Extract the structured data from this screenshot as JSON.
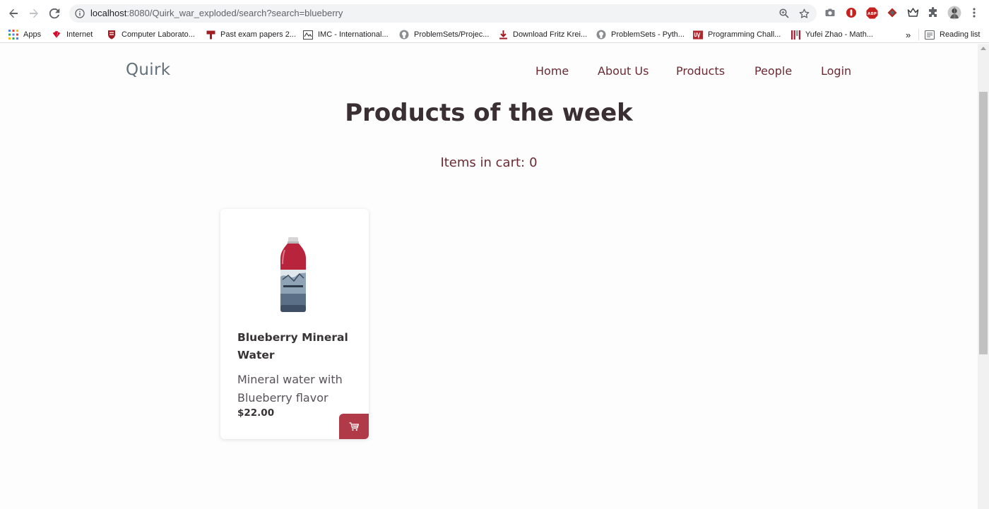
{
  "browser": {
    "url_host": "localhost",
    "url_rest": ":8080/Quirk_war_exploded/search?search=blueberry",
    "bookmarks": [
      {
        "label": "Apps"
      },
      {
        "label": "Internet"
      },
      {
        "label": "Computer Laborato..."
      },
      {
        "label": "Past exam papers 2..."
      },
      {
        "label": "IMC - International..."
      },
      {
        "label": "ProblemSets/Projec..."
      },
      {
        "label": "Download Fritz Krei..."
      },
      {
        "label": "ProblemSets - Pyth..."
      },
      {
        "label": "Programming Chall..."
      },
      {
        "label": "Yufei Zhao - Math..."
      }
    ],
    "overflow_label": "»",
    "reading_list": "Reading list",
    "ext_abp_label": "ABP"
  },
  "site": {
    "brand": "Quirk",
    "nav": [
      {
        "label": "Home"
      },
      {
        "label": "About Us"
      },
      {
        "label": "Products"
      },
      {
        "label": "People"
      },
      {
        "label": "Login"
      }
    ]
  },
  "main": {
    "title": "Products of the week",
    "cart_label": "Items in cart:",
    "cart_count": "0"
  },
  "products": [
    {
      "name": "Blueberry Mineral Water",
      "description": "Mineral water with Blueberry flavor",
      "price": "$22.00"
    }
  ],
  "colors": {
    "accent": "#b03a48",
    "nav_text": "#6b2a33",
    "brand_text": "#62707a",
    "title_text": "#3a3033"
  }
}
